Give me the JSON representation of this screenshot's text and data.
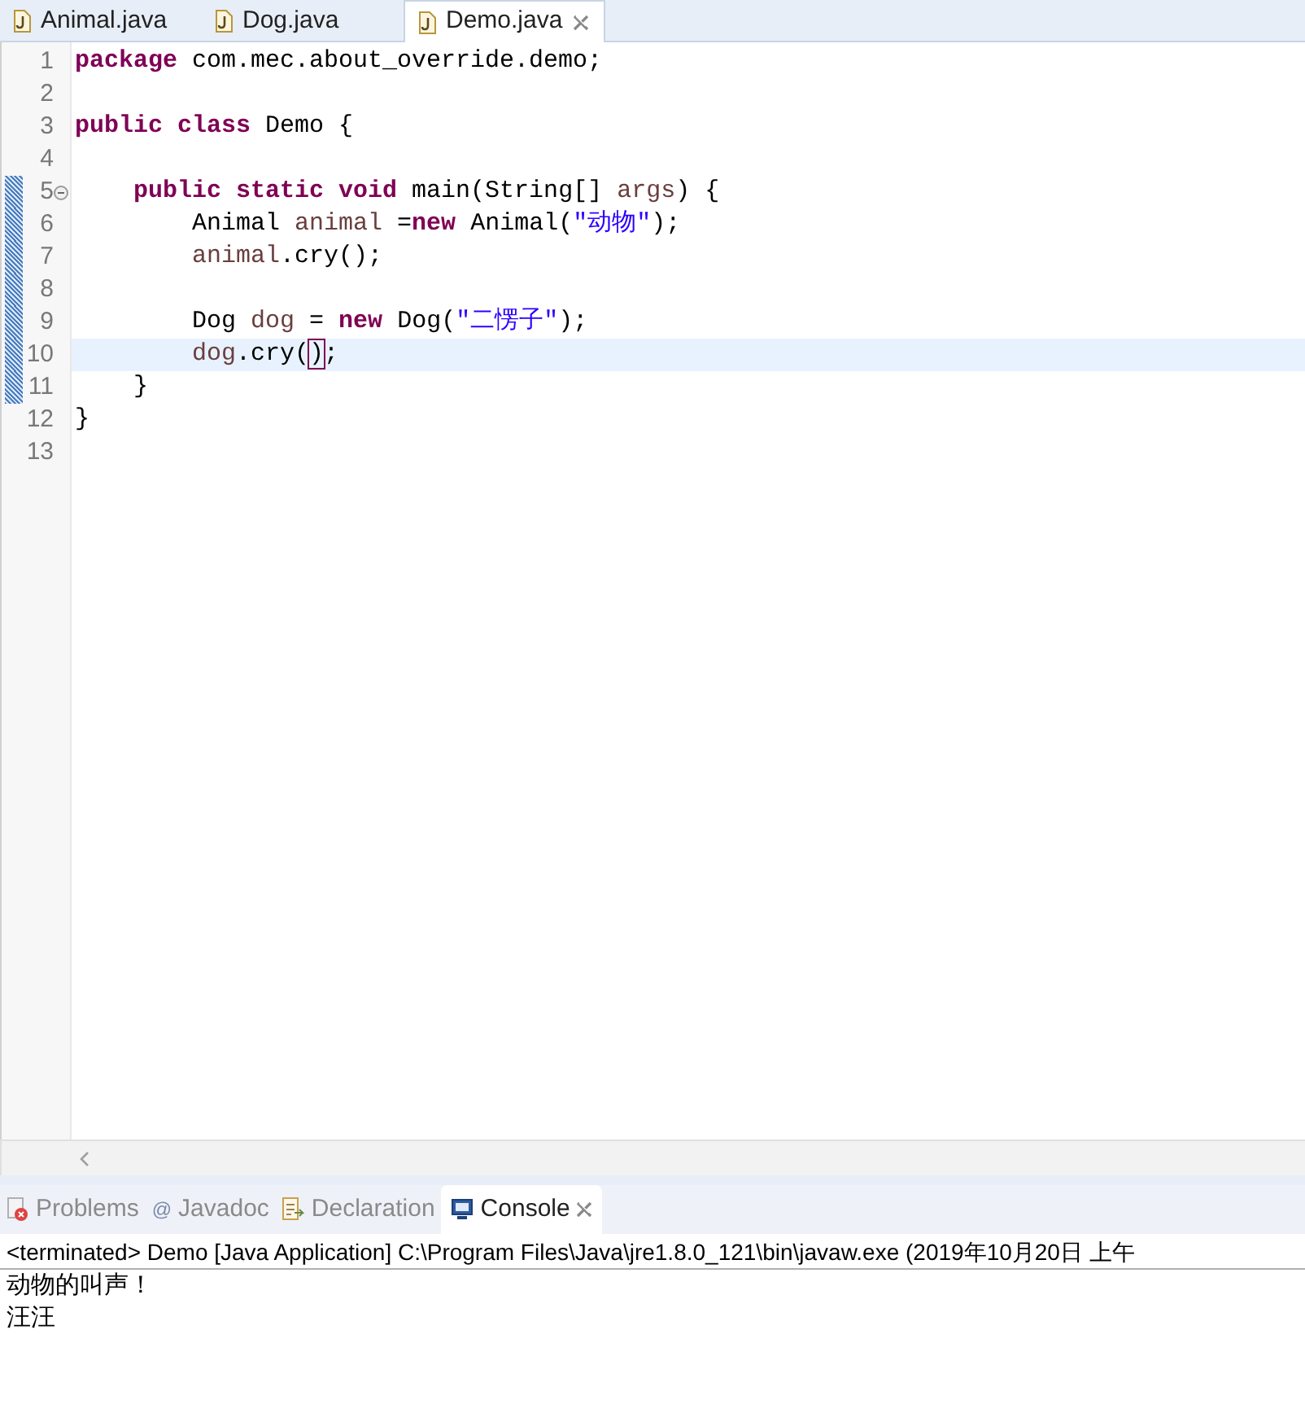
{
  "editor_tabs": [
    {
      "label": "Animal.java",
      "selected": false,
      "closable": false
    },
    {
      "label": "Dog.java",
      "selected": false,
      "closable": false
    },
    {
      "label": "Demo.java",
      "selected": true,
      "closable": true
    }
  ],
  "code_lines": [
    {
      "number": "1",
      "changed": false,
      "current": false,
      "foldable": false,
      "tokens": [
        {
          "kind": "keyword",
          "text": "package"
        },
        {
          "kind": "plain",
          "text": " com.mec.about_override.demo;"
        }
      ]
    },
    {
      "number": "2",
      "changed": false,
      "current": false,
      "foldable": false
    },
    {
      "number": "3",
      "changed": false,
      "current": false,
      "foldable": false,
      "tokens": [
        {
          "kind": "keyword",
          "text": "public"
        },
        {
          "kind": "keyword",
          "text": " class"
        },
        {
          "kind": "plain",
          "text": " Demo {"
        }
      ]
    },
    {
      "number": "4",
      "changed": false,
      "current": false,
      "foldable": false
    },
    {
      "number": "5",
      "changed": true,
      "current": false,
      "foldable": true,
      "tokens": [
        {
          "kind": "keyword",
          "text": "    public"
        },
        {
          "kind": "keyword",
          "text": " static"
        },
        {
          "kind": "keyword",
          "text": " void"
        },
        {
          "kind": "plain",
          "text": " main(String[] "
        },
        {
          "kind": "local",
          "text": "args"
        },
        {
          "kind": "plain",
          "text": ") {"
        }
      ]
    },
    {
      "number": "6",
      "changed": true,
      "current": false,
      "foldable": false,
      "tokens": [
        {
          "kind": "plain",
          "text": "        Animal "
        },
        {
          "kind": "local",
          "text": "animal"
        },
        {
          "kind": "plain",
          "text": " ="
        },
        {
          "kind": "keyword",
          "text": "new"
        },
        {
          "kind": "plain",
          "text": " Animal("
        },
        {
          "kind": "string",
          "text": "\"动物\""
        },
        {
          "kind": "plain",
          "text": ");"
        }
      ]
    },
    {
      "number": "7",
      "changed": true,
      "current": false,
      "foldable": false,
      "tokens": [
        {
          "kind": "local",
          "text": "        animal"
        },
        {
          "kind": "plain",
          "text": ".cry();"
        }
      ]
    },
    {
      "number": "8",
      "changed": true,
      "current": false,
      "foldable": false
    },
    {
      "number": "9",
      "changed": true,
      "current": false,
      "foldable": false,
      "tokens": [
        {
          "kind": "plain",
          "text": "        Dog "
        },
        {
          "kind": "local",
          "text": "dog"
        },
        {
          "kind": "plain",
          "text": " = "
        },
        {
          "kind": "keyword",
          "text": "new"
        },
        {
          "kind": "plain",
          "text": " Dog("
        },
        {
          "kind": "string",
          "text": "\"二愣子\""
        },
        {
          "kind": "plain",
          "text": ");"
        }
      ]
    },
    {
      "number": "10",
      "changed": true,
      "current": true,
      "foldable": false,
      "tokens": [
        {
          "kind": "local",
          "text": "        dog"
        },
        {
          "kind": "plain",
          "text": ".cry("
        },
        {
          "kind": "match",
          "text": ")"
        },
        {
          "kind": "plain",
          "text": ";"
        }
      ]
    },
    {
      "number": "11",
      "changed": true,
      "current": false,
      "foldable": false,
      "tokens": [
        {
          "kind": "plain",
          "text": "    }"
        }
      ]
    },
    {
      "number": "12",
      "changed": false,
      "current": false,
      "foldable": false,
      "tokens": [
        {
          "kind": "plain",
          "text": "}"
        }
      ]
    },
    {
      "number": "13",
      "changed": false,
      "current": false,
      "foldable": false
    }
  ],
  "view_tabs": [
    {
      "label": "Problems",
      "selected": false,
      "closable": false
    },
    {
      "symbol": "@",
      "label": "Javadoc",
      "selected": false,
      "closable": false
    },
    {
      "label": "Declaration",
      "selected": false,
      "closable": false
    },
    {
      "label": "Console",
      "selected": true,
      "closable": true
    }
  ],
  "console": {
    "header": "<terminated> Demo [Java Application] C:\\Program Files\\Java\\jre1.8.0_121\\bin\\javaw.exe (2019年10月20日 上午",
    "output": [
      "动物的叫声！",
      "汪汪"
    ]
  }
}
